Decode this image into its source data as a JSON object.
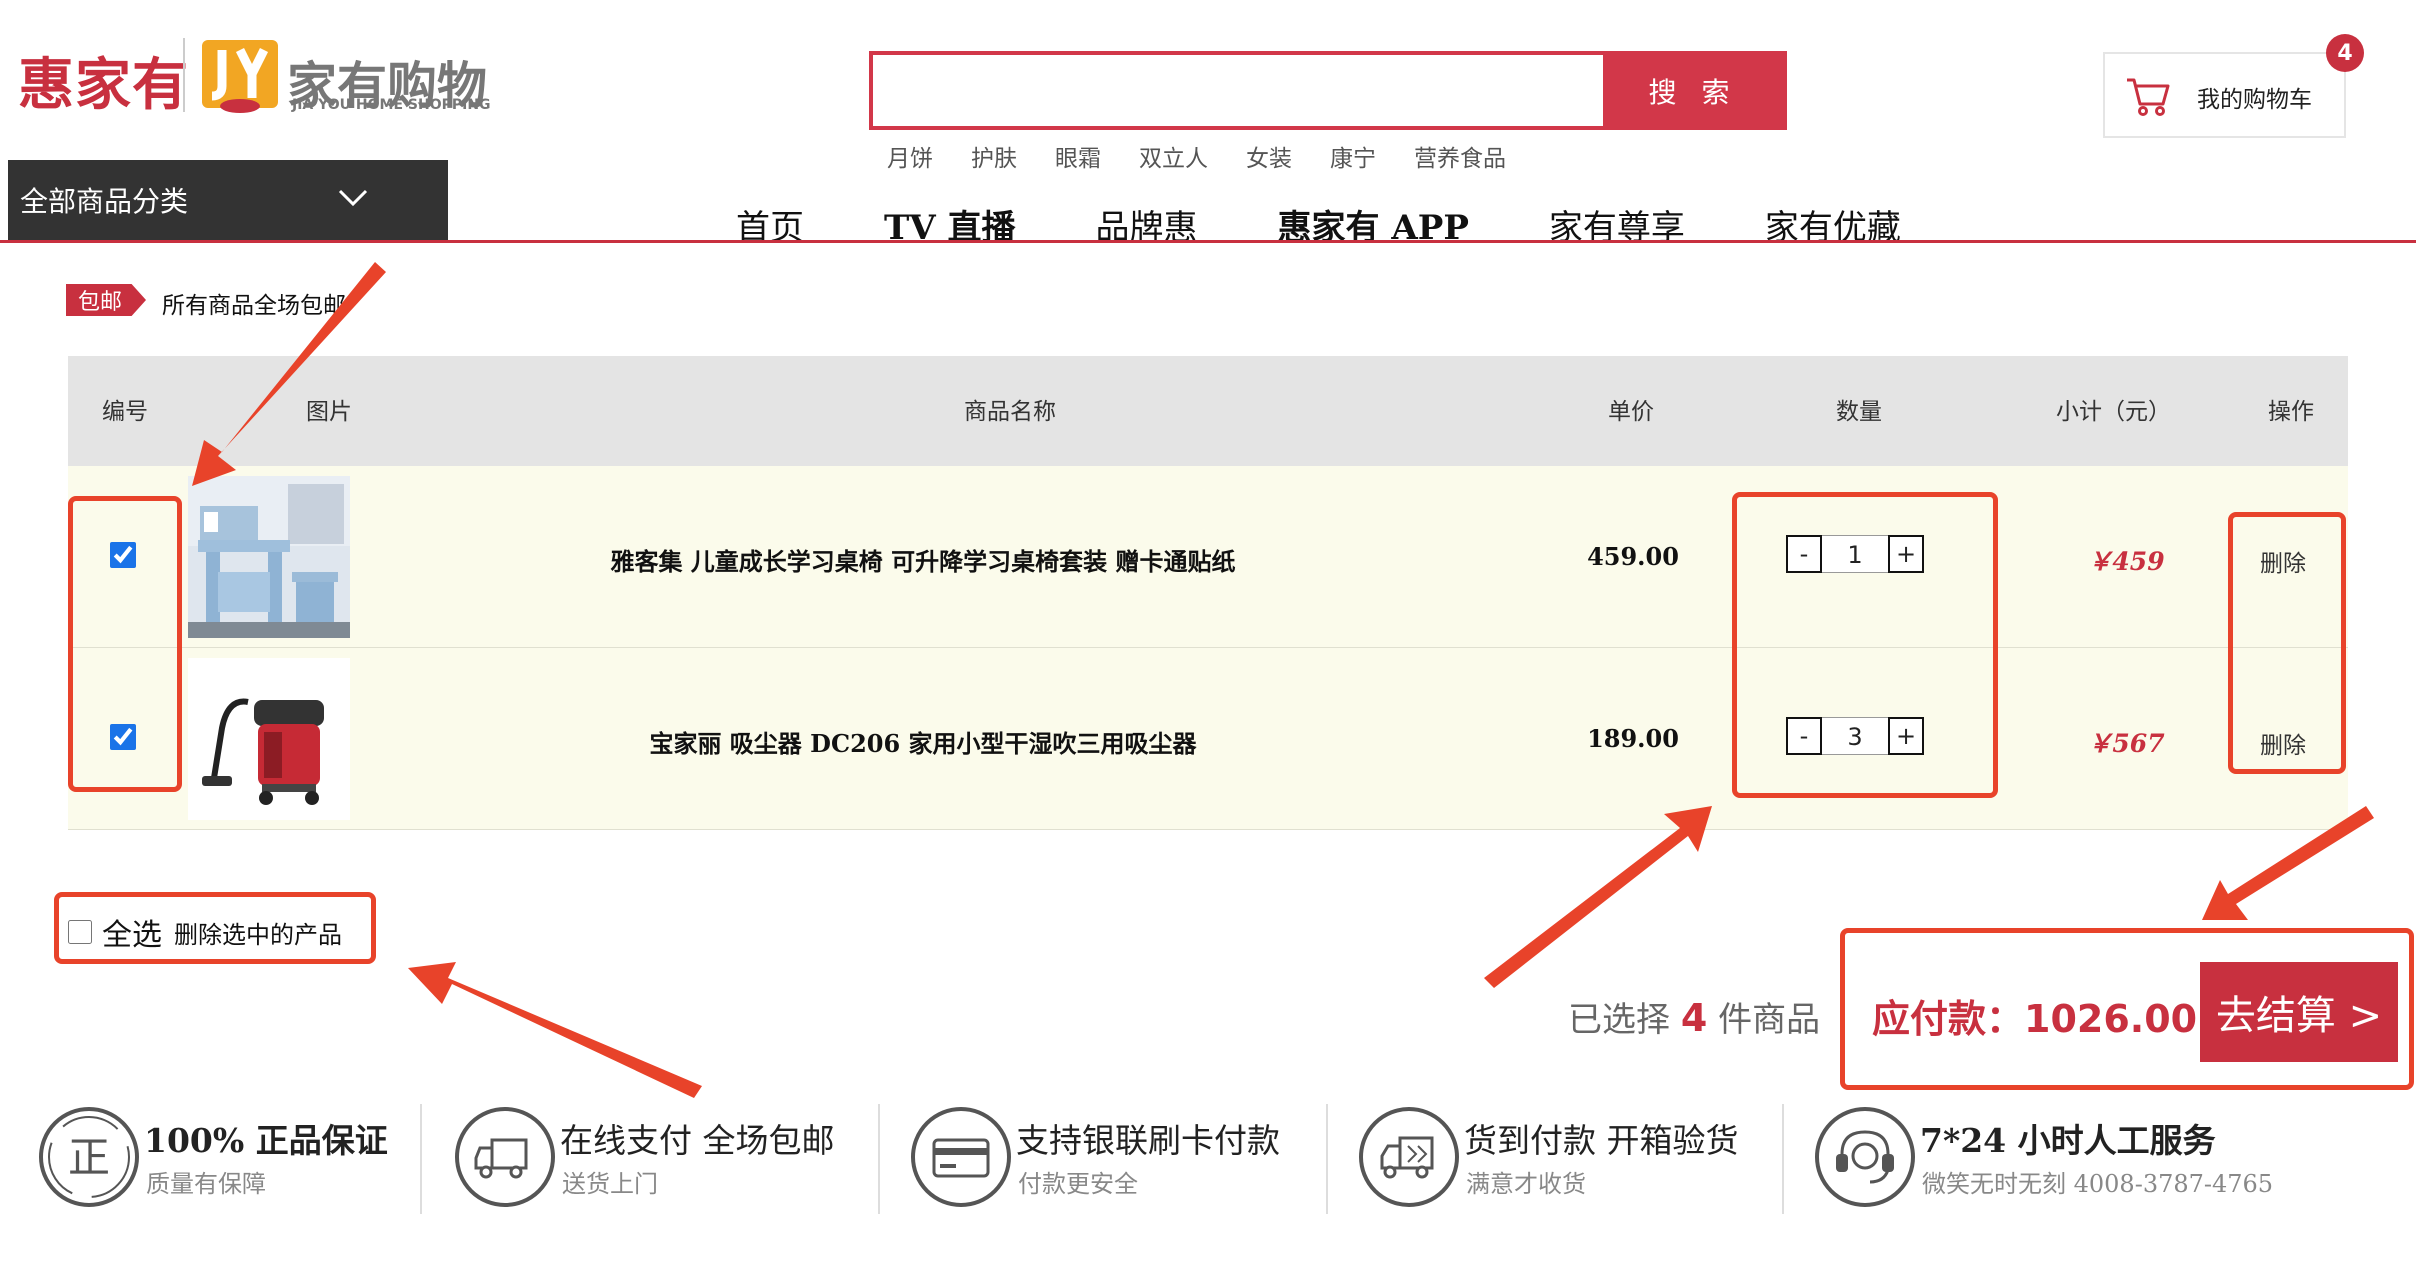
{
  "header": {
    "logo_text": "惠家有",
    "logo_brand": "家有购物",
    "logo_brand_sub": "JIA YOU HOME SHOPPING",
    "search": {
      "value": "",
      "placeholder": "",
      "button_label": "搜 索"
    },
    "hot_words": [
      "月饼",
      "护肤",
      "眼霜",
      "双立人",
      "女装",
      "康宁",
      "营养食品"
    ],
    "cart": {
      "label": "我的购物车",
      "badge_count": "4"
    },
    "category_menu_label": "全部商品分类",
    "nav": [
      "首页",
      "TV 直播",
      "品牌惠",
      "惠家有 APP",
      "家有尊享",
      "家有优藏"
    ]
  },
  "promo": {
    "tag": "包邮",
    "text": "所有商品全场包邮"
  },
  "table": {
    "headers": [
      "编号",
      "图片",
      "商品名称",
      "单价",
      "数量",
      "小计（元）",
      "操作"
    ],
    "rows": [
      {
        "checked": true,
        "name": "雅客集 儿童成长学习桌椅 可升降学习桌椅套装 赠卡通贴纸",
        "price": "459.00",
        "qty": "1",
        "subtotal": "￥459",
        "action": "删除",
        "image": "kids-desk-chair-image"
      },
      {
        "checked": true,
        "name": "宝家丽 吸尘器 DC206 家用小型干湿吹三用吸尘器",
        "price": "189.00",
        "qty": "3",
        "subtotal": "￥567",
        "action": "删除",
        "image": "vacuum-cleaner-image"
      }
    ],
    "qty_minus": "-",
    "qty_plus": "+"
  },
  "footer_bar": {
    "select_all_label": "全选",
    "delete_selected_label": "删除选中的产品",
    "selected_prefix": "已选择",
    "selected_count": "4",
    "selected_suffix": "件商品",
    "payable_label": "应付款：",
    "payable_amount": "1026.00",
    "checkout_label": "去结算 >"
  },
  "services": [
    {
      "icon": "genuine-icon",
      "title": "100% 正品保证",
      "sub": "质量有保障"
    },
    {
      "icon": "delivery-truck-icon",
      "title": "在线支付 全场包邮",
      "sub": "送货上门"
    },
    {
      "icon": "bank-card-icon",
      "title": "支持银联刷卡付款",
      "sub": "付款更安全"
    },
    {
      "icon": "cash-on-delivery-icon",
      "title": "货到付款 开箱验货",
      "sub": "满意才收货"
    },
    {
      "icon": "headset-service-icon",
      "title": "7*24 小时人工服务",
      "sub": "微笑无时无刻 4008-3787-4765"
    }
  ],
  "colors": {
    "brand_red": "#c8303f",
    "annotation_orange": "#e8432a",
    "category_bar": "#333333"
  }
}
